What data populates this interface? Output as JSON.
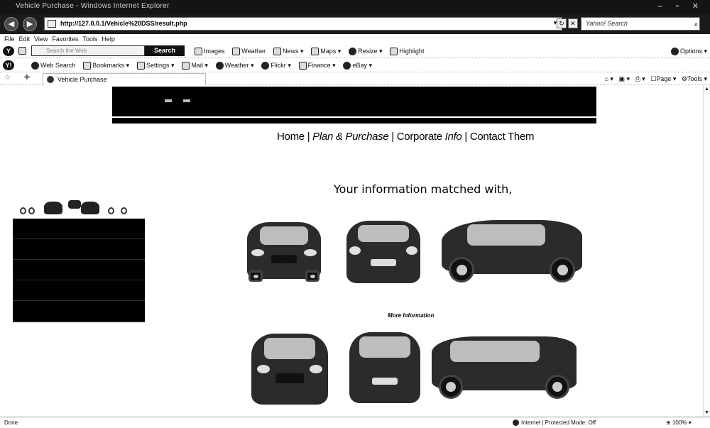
{
  "browser": {
    "title": "Vehicle Purchase - Windows Internet Explorer",
    "url": "http://127.0.0.1/Vehicle%20DSS/result.php",
    "search_placeholder": "Yahoo! Search",
    "menu": [
      "File",
      "Edit",
      "View",
      "Favorites",
      "Tools",
      "Help"
    ],
    "toolbar1": {
      "search_placeholder": "Search the Web",
      "search_button": "Search",
      "links": [
        "Images",
        "Weather",
        "News",
        "Maps",
        "Resize",
        "Highlight"
      ],
      "options": "Options"
    },
    "toolbar2": {
      "links": [
        "Web Search",
        "Bookmarks",
        "Settings",
        "Mail",
        "Weather",
        "Flickr",
        "Finance",
        "eBay"
      ]
    },
    "tab_title": "Vehicle Purchase",
    "command_bar": [
      "Page",
      "Tools"
    ],
    "status": "Done",
    "zone": "Internet | Protected Mode: Off",
    "zoom": "100%"
  },
  "site": {
    "nav": {
      "home": "Home",
      "sep": "|",
      "plan": "Plan & Purchase",
      "corp_a": "Corporate",
      "corp_b": "Info",
      "contact": "Contact Them"
    },
    "matched_heading": "Your information matched with,",
    "more_info": "More Information"
  },
  "colors": {
    "chrome_dark": "#1b1b1b",
    "banner": "#000000",
    "sidebar": "#000000"
  }
}
